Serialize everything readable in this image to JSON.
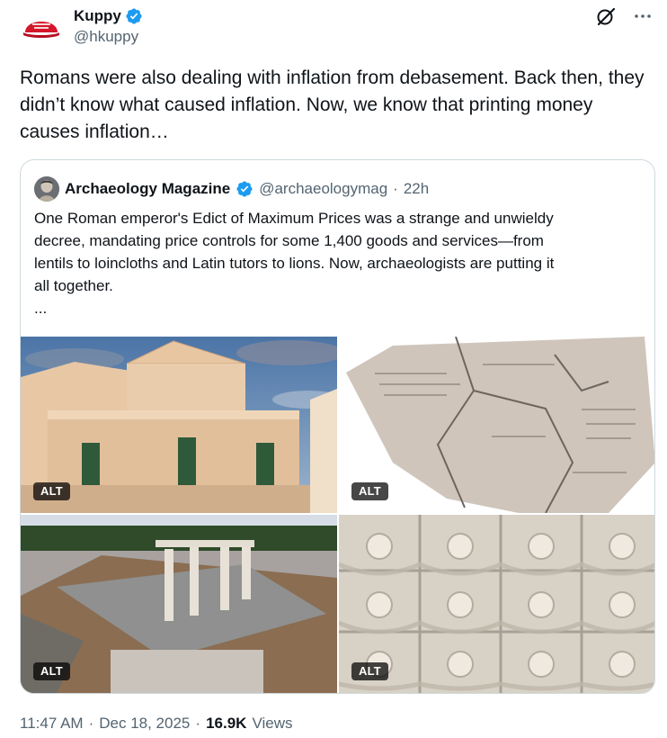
{
  "author": {
    "display_name": "Kuppy",
    "handle": "@hkuppy",
    "avatar_icon": "red-cap-avatar",
    "verified": true
  },
  "header_actions": {
    "grok_icon": "grok-slash-icon",
    "more_icon": "more-dots-icon"
  },
  "tweet": {
    "text": "Romans were also dealing with inflation from debasement. Back then, they didn’t know what caused inflation. Now, we know that printing money causes inflation…"
  },
  "quote": {
    "author_name": "Archaeology Magazine",
    "verified": true,
    "handle": "@archaeologymag",
    "dot": "·",
    "time": "22h",
    "text_line1": "One Roman emperor's Edict of Maximum Prices was a strange and unwieldy",
    "text_line2": "decree, mandating price controls for some 1,400 goods and services—from",
    "text_line3": "lentils to loincloths and Latin tutors to lions. Now, archaeologists are putting it",
    "text_line4": "all together.",
    "text_line5": "...",
    "media": [
      {
        "alt_label": "ALT"
      },
      {
        "alt_label": "ALT"
      },
      {
        "alt_label": "ALT"
      },
      {
        "alt_label": "ALT"
      }
    ]
  },
  "meta": {
    "time": "11:47 AM",
    "dot1": "·",
    "date": "Dec 18, 2025",
    "dot2": "·",
    "views_count": "16.9K",
    "views_label": "Views"
  },
  "colors": {
    "text": "#0f1419",
    "secondary": "#536471",
    "verified": "#1d9bf0",
    "border": "#cfd9de"
  }
}
